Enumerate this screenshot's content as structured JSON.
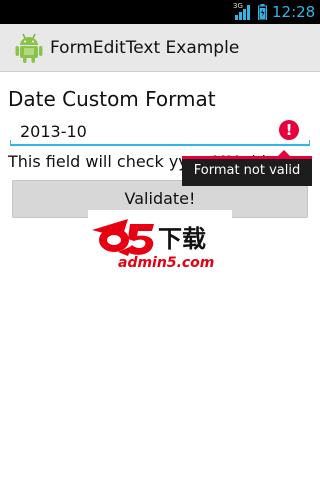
{
  "status_bar": {
    "network_type": "3G",
    "time": "12:28",
    "accent_color": "#33b5e5",
    "icons": [
      "signal-icon",
      "battery-icon"
    ]
  },
  "action_bar": {
    "icon": "android-icon",
    "title": "FormEditText Example"
  },
  "form": {
    "label": "Date Custom Format",
    "input_value": "2013-10",
    "error_icon": "!",
    "helper_text": "This field will check yyyy-MM-dd",
    "error_message": "Format not valid",
    "error_color": "#e8003d",
    "validate_label": "Validate!"
  },
  "watermark": {
    "brand": "a5下载",
    "url": "admin5.com"
  }
}
